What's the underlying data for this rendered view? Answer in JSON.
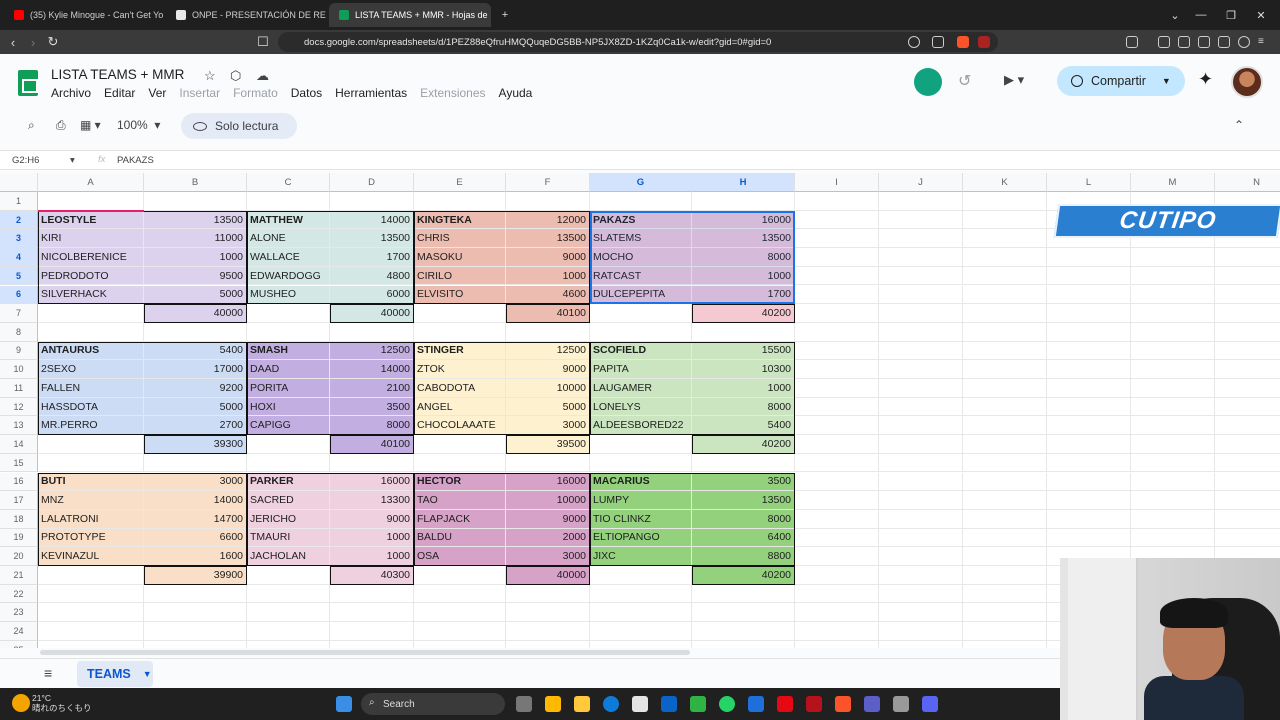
{
  "browser": {
    "tabs": [
      {
        "label": "(35) Kylie Minogue - Can't Get Yo",
        "active": false
      },
      {
        "label": "ONPE - PRESENTACIÓN DE RESULTA",
        "active": false
      },
      {
        "label": "LISTA TEAMS + MMR - Hojas de",
        "active": true
      }
    ],
    "url": "docs.google.com/spreadsheets/d/1PEZ88eQfruHMQQuqeDG5BB-NP5JX8ZD-1KZq0Ca1k-w/edit?gid=0#gid=0"
  },
  "sheets": {
    "doc_title": "LISTA TEAMS + MMR",
    "menu": [
      "Archivo",
      "Editar",
      "Ver",
      "Insertar",
      "Formato",
      "Datos",
      "Herramientas",
      "Extensiones",
      "Ayuda"
    ],
    "menu_disabled": [
      "Insertar",
      "Formato",
      "Extensiones"
    ],
    "share_label": "Compartir",
    "zoom": "100%",
    "read_only_label": "Solo lectura",
    "name_box": "G2:H6",
    "formula_value": "PAKAZS",
    "sheet_tab": "TEAMS",
    "columns": [
      "A",
      "B",
      "C",
      "D",
      "E",
      "F",
      "G",
      "H",
      "I",
      "J",
      "K",
      "L",
      "M",
      "N"
    ],
    "selected_columns": [
      "G",
      "H"
    ],
    "selected_rows": [
      2,
      3,
      4,
      5,
      6
    ],
    "rows": [
      "1",
      "2",
      "3",
      "4",
      "5",
      "6",
      "7",
      "8",
      "9",
      "10",
      "11",
      "12",
      "13",
      "14",
      "15",
      "16",
      "17",
      "18",
      "19",
      "20",
      "21",
      "22",
      "23",
      "24",
      "25"
    ],
    "teams": [
      {
        "captain": "LEOSTYLE",
        "captain_mmr": "13500",
        "players": [
          [
            "KIRI",
            "11000"
          ],
          [
            "NICOLBERENICE",
            "1000"
          ],
          [
            "PEDRODOTO",
            "9500"
          ],
          [
            "SILVERHACK",
            "5000"
          ]
        ],
        "total": "40000",
        "color": "#dcd2ee"
      },
      {
        "captain": "MATTHEW",
        "captain_mmr": "14000",
        "players": [
          [
            "ALONE",
            "13500"
          ],
          [
            "WALLACE",
            "1700"
          ],
          [
            "EDWARDOGG",
            "4800"
          ],
          [
            "MUSHEO",
            "6000"
          ]
        ],
        "total": "40000",
        "color": "#d3e8e4"
      },
      {
        "captain": "KINGTEKA",
        "captain_mmr": "12000",
        "players": [
          [
            "CHRIS",
            "13500"
          ],
          [
            "MASOKU",
            "9000"
          ],
          [
            "CIRILO",
            "1000"
          ],
          [
            "ELVISITO",
            "4600"
          ]
        ],
        "total": "40100",
        "color": "#ecbcb1"
      },
      {
        "captain": "PAKAZS",
        "captain_mmr": "16000",
        "players": [
          [
            "SLATEMS",
            "13500"
          ],
          [
            "MOCHO",
            "8000"
          ],
          [
            "RATCAST",
            "1000"
          ],
          [
            "DULCEPEPITA",
            "1700"
          ]
        ],
        "total": "40200",
        "color": "#e6c1d9",
        "total_color": "#f5c9d2"
      },
      {
        "captain": "ANTAURUS",
        "captain_mmr": "5400",
        "players": [
          [
            "2SEXO",
            "17000"
          ],
          [
            "FALLEN",
            "9200"
          ],
          [
            "HASSDOTA",
            "5000"
          ],
          [
            "MR.PERRO",
            "2700"
          ]
        ],
        "total": "39300",
        "color": "#cddcf5"
      },
      {
        "captain": "SMASH",
        "captain_mmr": "12500",
        "players": [
          [
            "DAAD",
            "14000"
          ],
          [
            "PORITA",
            "2100"
          ],
          [
            "HOXI",
            "3500"
          ],
          [
            "CAPIGG",
            "8000"
          ]
        ],
        "total": "40100",
        "color": "#c2aee0"
      },
      {
        "captain": "STINGER",
        "captain_mmr": "12500",
        "players": [
          [
            "ZTOK",
            "9000"
          ],
          [
            "CABODOTA",
            "10000"
          ],
          [
            "ANGEL",
            "5000"
          ],
          [
            "CHOCOLAAATE",
            "3000"
          ]
        ],
        "total": "39500",
        "color": "#fdf1cf"
      },
      {
        "captain": "SCOFIELD",
        "captain_mmr": "15500",
        "players": [
          [
            "PAPITA",
            "10300"
          ],
          [
            "LAUGAMER",
            "1000"
          ],
          [
            "LONELYS",
            "8000"
          ],
          [
            "ALDEESBORED22",
            "5400"
          ]
        ],
        "total": "40200",
        "color": "#cae5c0"
      },
      {
        "captain": "BUTI",
        "captain_mmr": "3000",
        "players": [
          [
            "MNZ",
            "14000"
          ],
          [
            "LALATRONI",
            "14700"
          ],
          [
            "PROTOTYPE",
            "6600"
          ],
          [
            "KEVINAZUL",
            "1600"
          ]
        ],
        "total": "39900",
        "color": "#f9dfc7"
      },
      {
        "captain": "PARKER",
        "captain_mmr": "16000",
        "players": [
          [
            "SACRED",
            "13300"
          ],
          [
            "JERICHO",
            "9000"
          ],
          [
            "TMAURI",
            "1000"
          ],
          [
            "JACHOLAN",
            "1000"
          ]
        ],
        "total": "40300",
        "color": "#eed0df"
      },
      {
        "captain": "HECTOR",
        "captain_mmr": "16000",
        "players": [
          [
            "TAO",
            "10000"
          ],
          [
            "FLAPJACK",
            "9000"
          ],
          [
            "BALDU",
            "2000"
          ],
          [
            "OSA",
            "3000"
          ]
        ],
        "total": "40000",
        "color": "#d7a2c7"
      },
      {
        "captain": "MACARIUS",
        "captain_mmr": "3500",
        "players": [
          [
            "LUMPY",
            "13500"
          ],
          [
            "TIO CLINKZ",
            "8000"
          ],
          [
            "ELTIOPANGO",
            "6400"
          ],
          [
            "JIXC",
            "8800"
          ]
        ],
        "total": "40200",
        "color": "#93d17d"
      }
    ]
  },
  "overlay": {
    "brand_text": "CUTIPO"
  },
  "taskbar": {
    "search_label": "Search",
    "weather_temp": "21°C",
    "weather_desc": "晴れのちくもり"
  }
}
